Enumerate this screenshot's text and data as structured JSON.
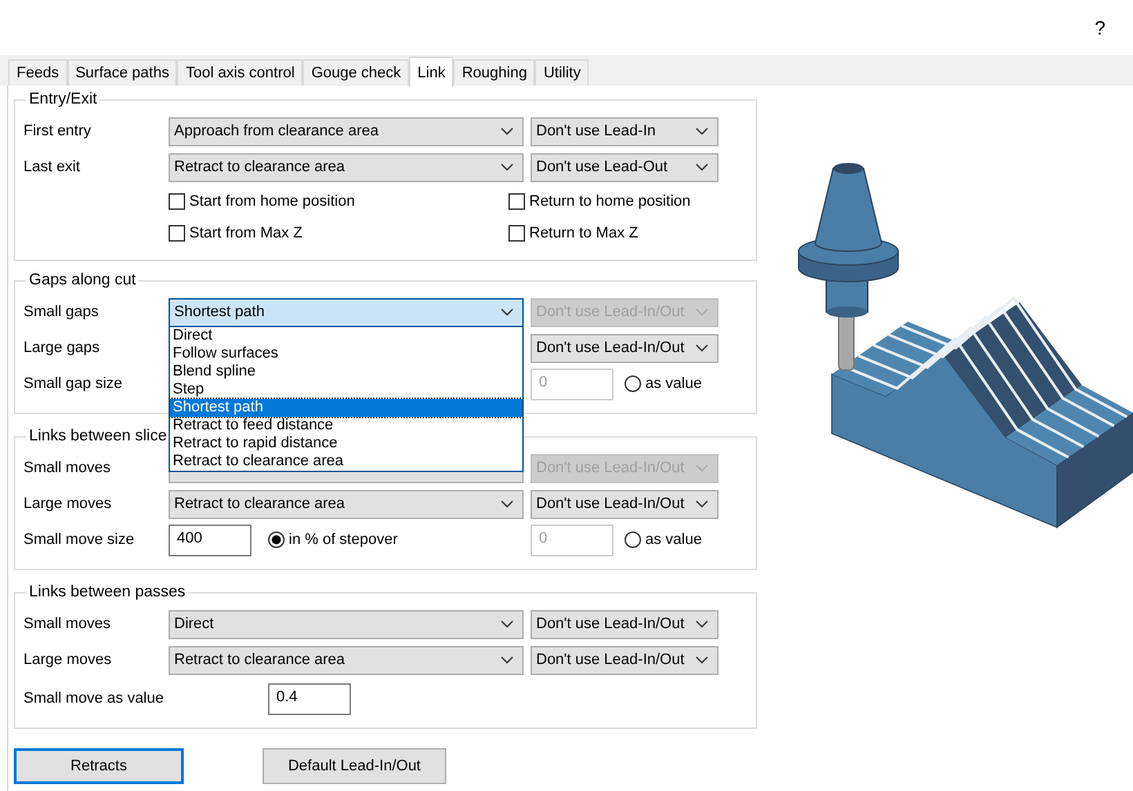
{
  "help": "?",
  "tabs": [
    {
      "label": "Feeds",
      "selected": false
    },
    {
      "label": "Surface paths",
      "selected": false
    },
    {
      "label": "Tool axis control",
      "selected": false
    },
    {
      "label": "Gouge check",
      "selected": false
    },
    {
      "label": "Link",
      "selected": true
    },
    {
      "label": "Roughing",
      "selected": false
    },
    {
      "label": "Utility",
      "selected": false
    }
  ],
  "groups": [
    {
      "title": "Entry/Exit",
      "rows": [
        {
          "kind": "combos",
          "label": "First entry",
          "main": {
            "value": "Approach from clearance area",
            "disabled": false
          },
          "lead": {
            "value": "Don't use Lead-In",
            "disabled": false
          }
        },
        {
          "kind": "combos",
          "label": "Last exit",
          "main": {
            "value": "Retract to clearance area",
            "disabled": false
          },
          "lead": {
            "value": "Don't use Lead-Out",
            "disabled": false
          }
        },
        {
          "kind": "checks",
          "left": {
            "label": "Start from home position",
            "checked": false
          },
          "right": {
            "label": "Return to home position",
            "checked": false
          }
        },
        {
          "kind": "checks",
          "left": {
            "label": "Start from Max Z",
            "checked": false
          },
          "right": {
            "label": "Return to Max Z",
            "checked": false
          }
        }
      ]
    },
    {
      "title": "Gaps along cut",
      "rows": [
        {
          "kind": "combos",
          "label": "Small gaps",
          "main": {
            "value": "Shortest path",
            "disabled": false,
            "expanded": true,
            "options": [
              {
                "label": "Direct",
                "selected": false
              },
              {
                "label": "Follow surfaces",
                "selected": false
              },
              {
                "label": "Blend spline",
                "selected": false
              },
              {
                "label": "Step",
                "selected": false
              },
              {
                "label": "Shortest path",
                "selected": true
              },
              {
                "label": "Retract to feed distance",
                "selected": false
              },
              {
                "label": "Retract to rapid distance",
                "selected": false
              },
              {
                "label": "Retract to clearance area",
                "selected": false
              }
            ]
          },
          "lead": {
            "value": "Don't use Lead-In/Out",
            "disabled": true
          }
        },
        {
          "kind": "combos",
          "label": "Large gaps",
          "lead": {
            "value": "Don't use Lead-In/Out",
            "disabled": false
          }
        },
        {
          "kind": "sizes",
          "label": "Small gap size",
          "right": {
            "value": "0",
            "disabled": true,
            "option": {
              "label": "as value",
              "selected": false
            }
          }
        }
      ]
    },
    {
      "title": "Links between slice",
      "rows": [
        {
          "kind": "combos",
          "label": "Small moves",
          "main": {
            "disabled": false
          },
          "lead": {
            "value": "Don't use Lead-In/Out",
            "disabled": true
          }
        },
        {
          "kind": "combos",
          "label": "Large moves",
          "main": {
            "value": "Retract to clearance area",
            "disabled": false
          },
          "lead": {
            "value": "Don't use Lead-In/Out",
            "disabled": false
          }
        },
        {
          "kind": "sizes",
          "label": "Small move size",
          "left": {
            "value": "400",
            "disabled": false,
            "option": {
              "label": "in % of stepover",
              "selected": true
            }
          },
          "right": {
            "value": "0",
            "disabled": true,
            "option": {
              "label": "as value",
              "selected": false
            }
          }
        }
      ]
    },
    {
      "title": "Links between passes",
      "rows": [
        {
          "kind": "combos",
          "label": "Small moves",
          "main": {
            "value": "Direct",
            "disabled": false
          },
          "lead": {
            "value": "Don't use Lead-In/Out",
            "disabled": false
          }
        },
        {
          "kind": "combos",
          "label": "Large moves",
          "main": {
            "value": "Retract to clearance area",
            "disabled": false
          },
          "lead": {
            "value": "Don't use Lead-In/Out",
            "disabled": false
          }
        },
        {
          "kind": "value",
          "label": "Small move as value",
          "field": {
            "value": "0.4"
          }
        }
      ]
    }
  ],
  "buttons": [
    {
      "label": "Retracts",
      "focused": true
    },
    {
      "label": "Default Lead-In/Out",
      "focused": false
    }
  ]
}
